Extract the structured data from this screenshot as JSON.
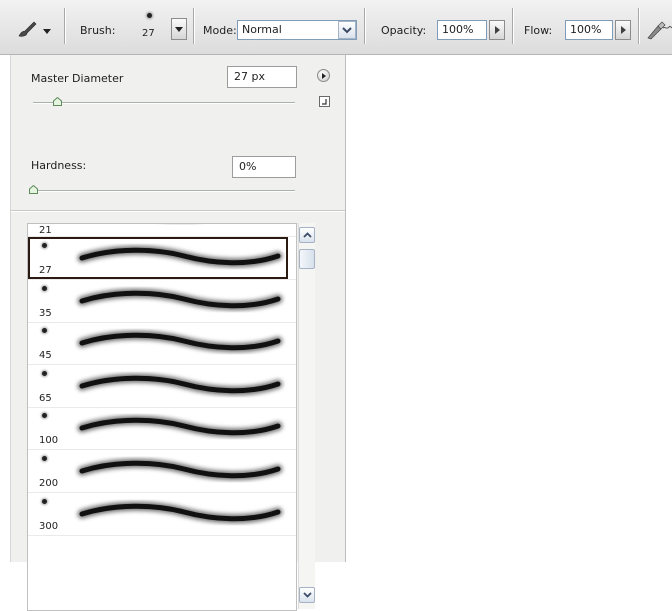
{
  "toolbar": {
    "brush_label": "Brush:",
    "brush_size": "27",
    "mode_label": "Mode:",
    "mode_value": "Normal",
    "opacity_label": "Opacity:",
    "opacity_value": "100%",
    "flow_label": "Flow:",
    "flow_value": "100%",
    "icons": [
      "brush-tool-icon",
      "tool-preset-dropdown-icon",
      "brush-picker-dropdown-icon",
      "mode-dropdown-icon",
      "opacity-slider-arrow-icon",
      "flow-slider-arrow-icon",
      "airbrush-icon"
    ]
  },
  "panel": {
    "master_diameter_label": "Master Diameter",
    "master_diameter_value": "27 px",
    "master_diameter_level": 0.09,
    "hardness_label": "Hardness:",
    "hardness_value": "0%",
    "hardness_level": 0.0,
    "icons": [
      "panel-menu-icon",
      "save-preset-icon"
    ]
  },
  "brush_list": {
    "selected": "27",
    "partial_top": "21",
    "items": [
      "27",
      "35",
      "45",
      "65",
      "100",
      "200",
      "300"
    ],
    "icons": [
      "scroll-up-icon",
      "scroll-down-icon"
    ]
  },
  "colors": {
    "toolbar_bg": "#e6e6e6",
    "panel_bg": "#f0f0ee",
    "selection_border": "#2a1a12",
    "field_border": "#7f9db9"
  }
}
